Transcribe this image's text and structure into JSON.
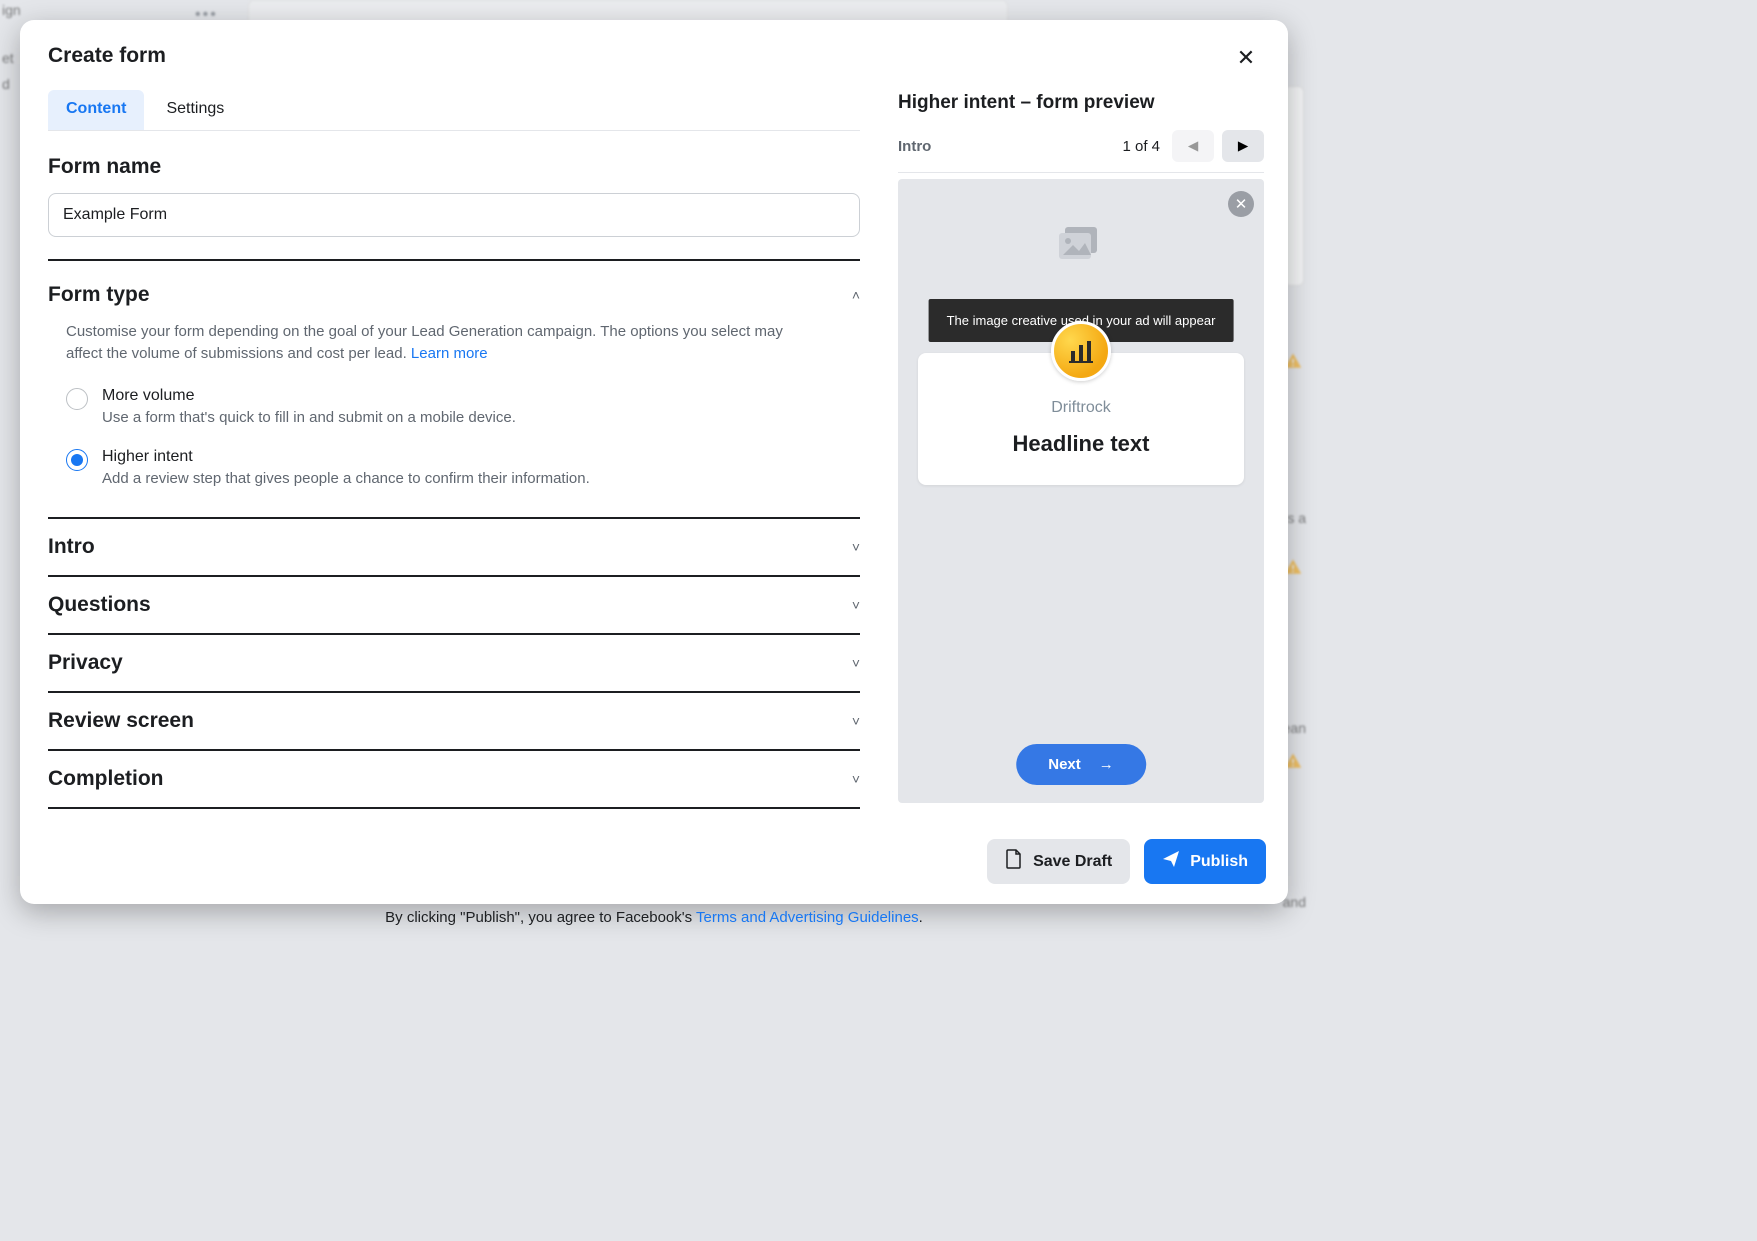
{
  "modal": {
    "title": "Create form",
    "tabs": {
      "content": "Content",
      "settings": "Settings"
    }
  },
  "form_name": {
    "label": "Form name",
    "value": "Example Form"
  },
  "form_type": {
    "label": "Form type",
    "description": "Customise your form depending on the goal of your Lead Generation campaign. The options you select may affect the volume of submissions and cost per lead. ",
    "learn_more": "Learn more",
    "options": {
      "more_volume": {
        "title": "More volume",
        "sub": "Use a form that's quick to fill in and submit on a mobile device."
      },
      "higher_intent": {
        "title": "Higher intent",
        "sub": "Add a review step that gives people a chance to confirm their information."
      }
    }
  },
  "accordion": {
    "intro": "Intro",
    "questions": "Questions",
    "privacy": "Privacy",
    "review": "Review screen",
    "completion": "Completion"
  },
  "preview": {
    "title": "Higher intent – form preview",
    "step_label": "Intro",
    "step_count": "1 of 4",
    "image_tooltip": "The image creative used in your ad will appear",
    "brand": "Driftrock",
    "headline": "Headline text",
    "next_label": "Next"
  },
  "footer": {
    "save_draft": "Save Draft",
    "publish": "Publish",
    "disclaimer_pre": "By clicking \"Publish\", you agree to Facebook's ",
    "disclaimer_link": "Terms and Advertising Guidelines",
    "disclaimer_post": "."
  },
  "bg": {
    "left1": "ign",
    "left2": "et",
    "left3": "d",
    "right1": "s a",
    "right2": "ean",
    "right3": "and"
  }
}
